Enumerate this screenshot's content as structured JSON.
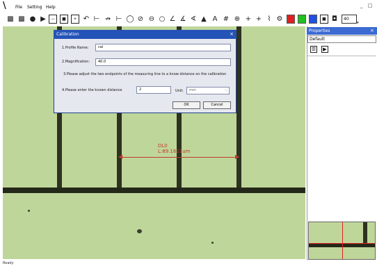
{
  "menu": {
    "items": [
      "File",
      "Setting",
      "Help"
    ]
  },
  "window_controls": {
    "minimize": "_",
    "restore": "□"
  },
  "toolbar": {
    "zoom_value": "40",
    "colors": [
      "#e02020",
      "#20c020",
      "#2050e0"
    ]
  },
  "measurement": {
    "name": "DL0",
    "length": "L:89.1621um"
  },
  "dialog": {
    "title": "Calibration",
    "close": "×",
    "profile_label": "1.Profile Name:",
    "profile_value": "cal",
    "magnification_label": "2.Magnification:",
    "magnification_value": "40.0",
    "instruction": "3.Please adjust the two endpoints of the measuring line to a know distance on the calibration",
    "distance_label": "4.Please enter the known distance",
    "distance_value": "2",
    "unit_label": "Unit:",
    "unit_value": "mm",
    "ok_label": "OK",
    "cancel_label": "Cancel"
  },
  "properties": {
    "title": "Properties",
    "close": "×",
    "profile": "Default"
  },
  "status": {
    "text": "Ready"
  }
}
